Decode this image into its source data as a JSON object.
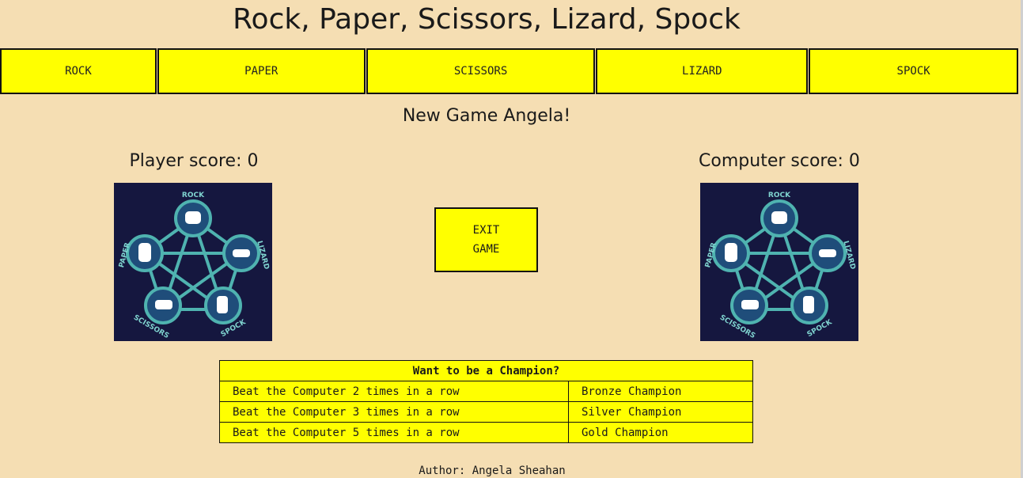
{
  "page_title": "Rock, Paper, Scissors, Lizard, Spock",
  "nav": [
    {
      "label": "ROCK"
    },
    {
      "label": "PAPER"
    },
    {
      "label": "SCISSORS"
    },
    {
      "label": "LIZARD"
    },
    {
      "label": "SPOCK"
    }
  ],
  "greeting": "New Game Angela!",
  "player_score": "Player score: 0",
  "computer_score": "Computer score: 0",
  "exit_button": {
    "line1": "EXIT",
    "line2": "GAME"
  },
  "diagram": {
    "rock": "ROCK",
    "paper": "PAPER",
    "lizard": "LIZARD",
    "scissors": "SCISSORS",
    "spock": "SPOCK"
  },
  "champion_table": {
    "header": "Want to be a Champion?",
    "rows": [
      {
        "condition": "Beat the Computer 2 times in a row",
        "award": "Bronze Champion"
      },
      {
        "condition": "Beat the Computer 3 times in a row",
        "award": "Silver Champion"
      },
      {
        "condition": "Beat the Computer 5 times in a row",
        "award": "Gold Champion"
      }
    ]
  },
  "author": "Author: Angela Sheahan",
  "colors": {
    "background": "#f5deb3",
    "button": "#ffff00",
    "diagram_bg": "#15173f",
    "diagram_ring": "#4fb3b0"
  }
}
